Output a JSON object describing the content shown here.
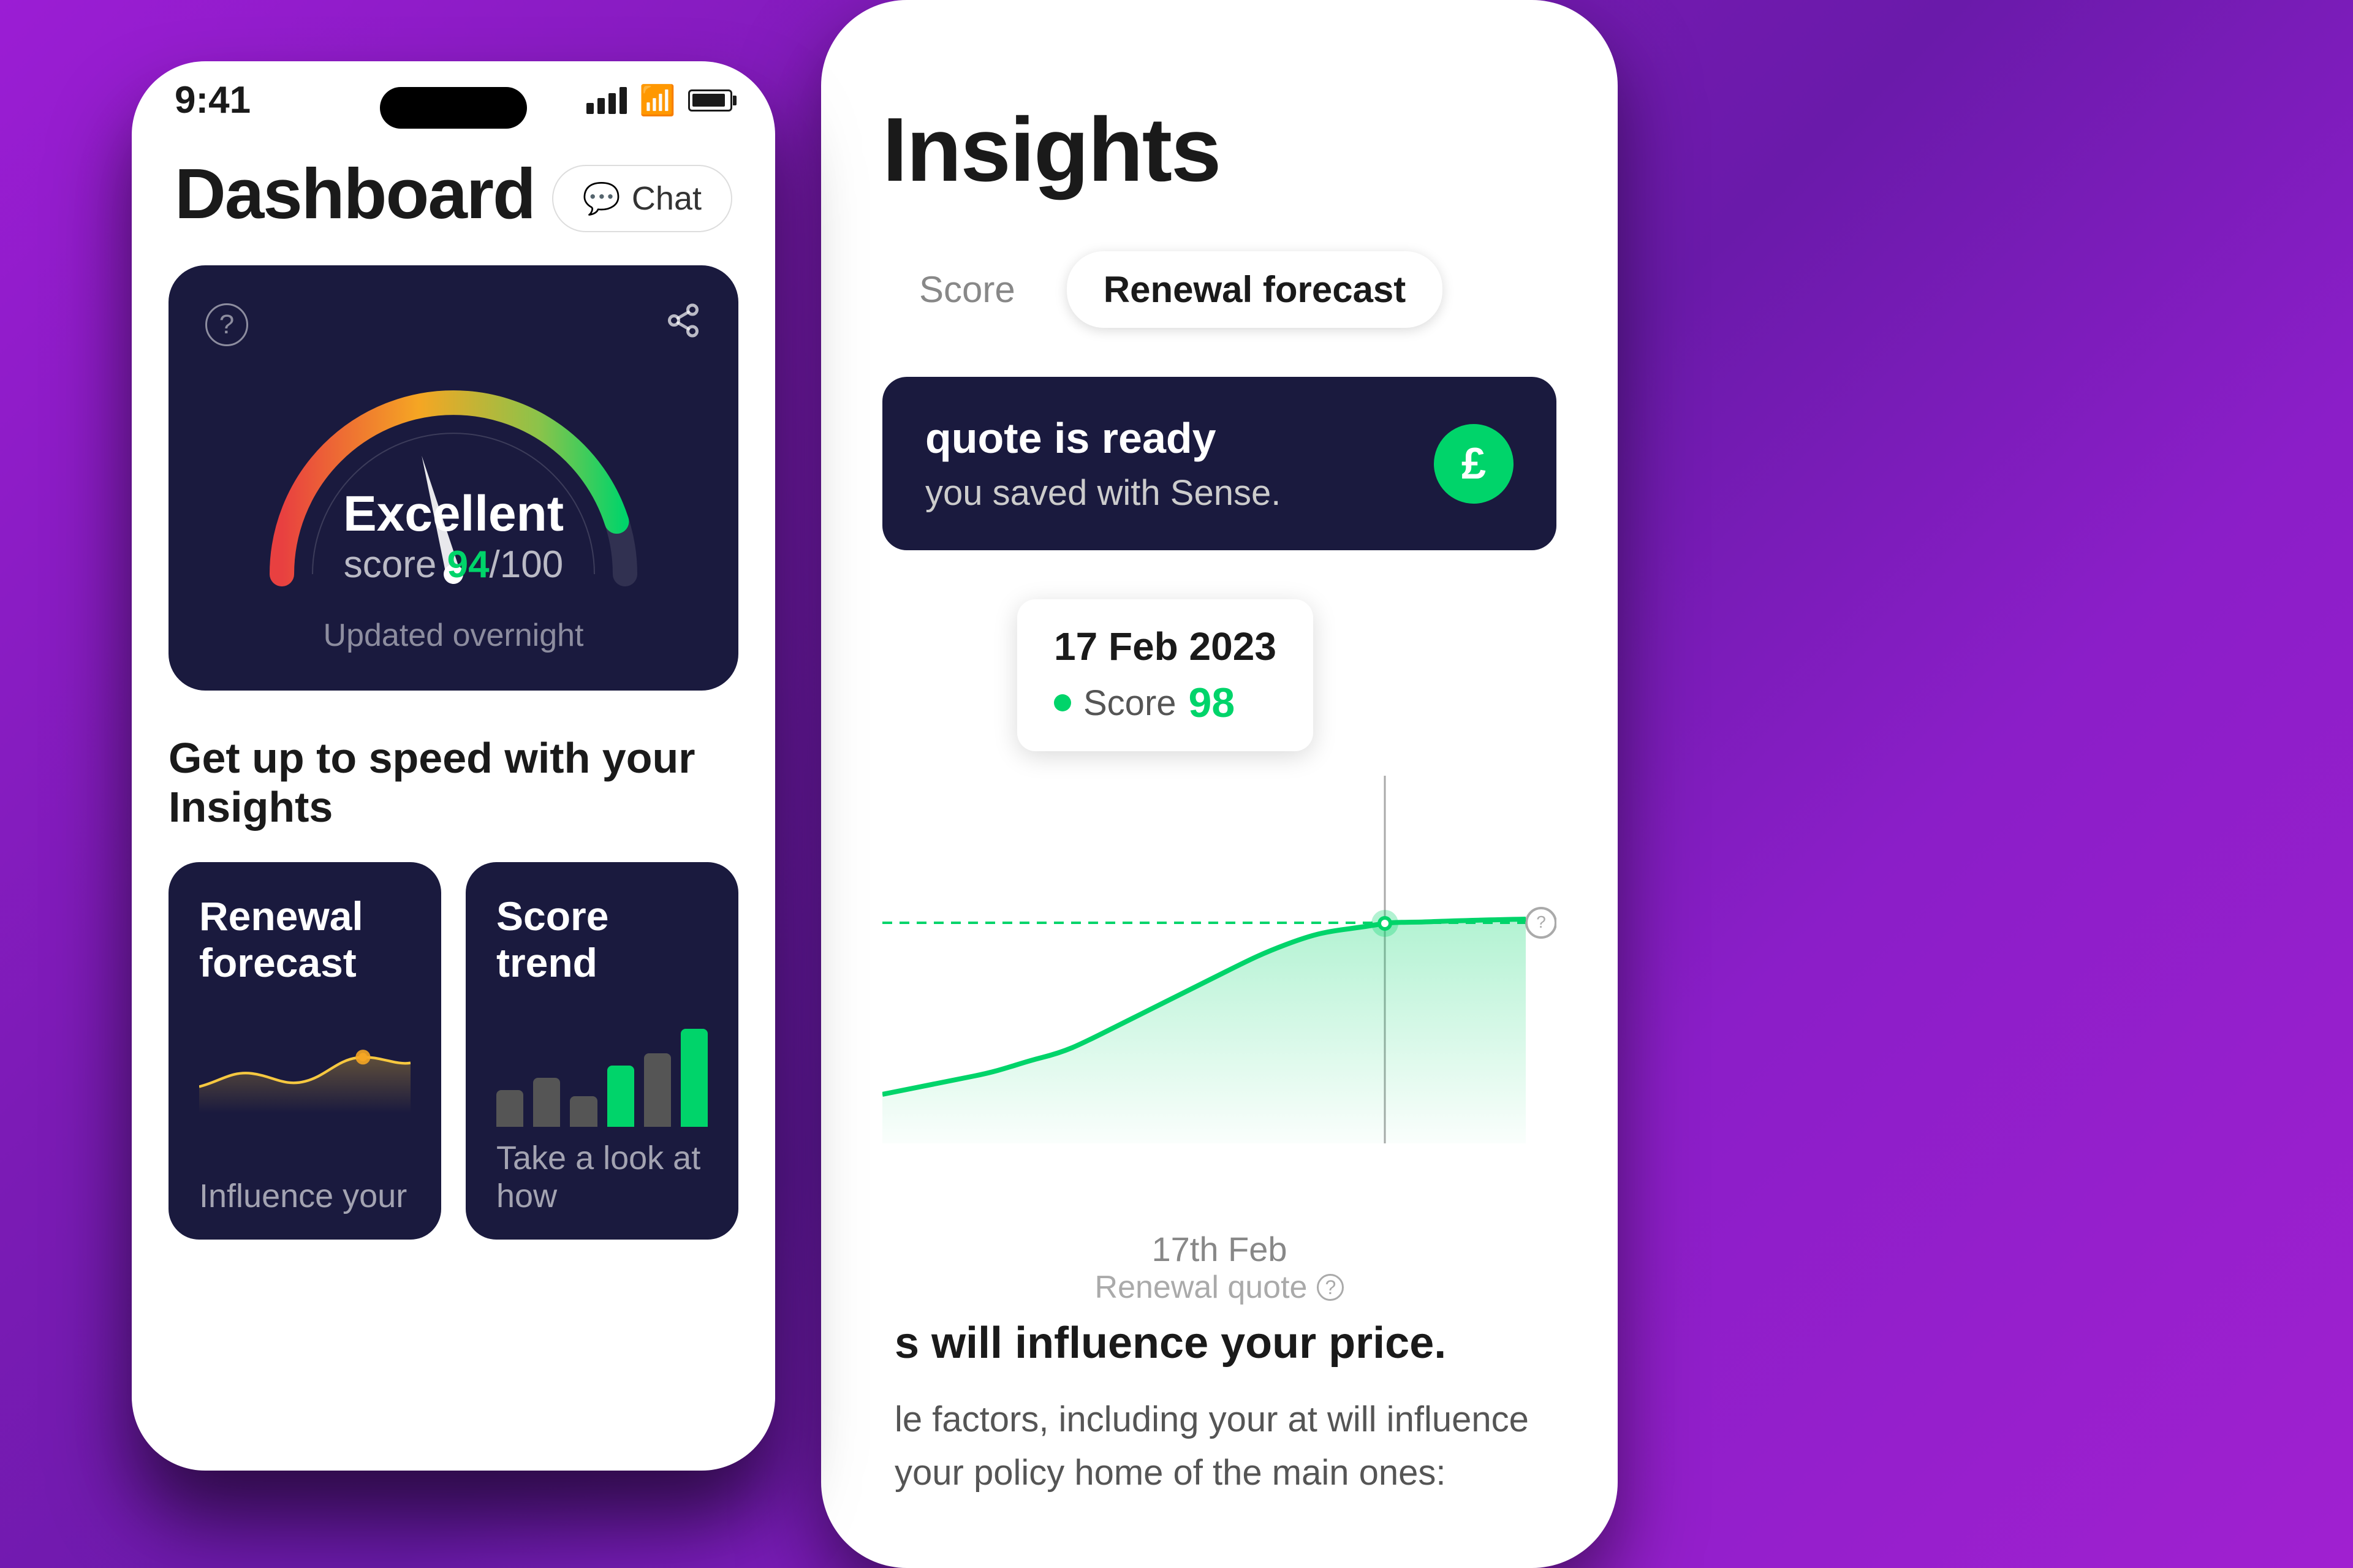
{
  "background": {
    "gradient_start": "#9b1dd4",
    "gradient_end": "#6a1aaa"
  },
  "back_phone": {
    "title": "Insights",
    "tabs": [
      {
        "label": "Score",
        "active": false
      },
      {
        "label": "Renewal forecast",
        "active": true
      }
    ],
    "banner": {
      "line1": "quote is ready",
      "line2": "you saved with Sense.",
      "badge": "£"
    },
    "tooltip": {
      "date": "17 Feb 2023",
      "score_label": "Score",
      "score_value": "98"
    },
    "chart_x_label": "17th Feb",
    "chart_x_sublabel": "Renewal quote",
    "influence": {
      "title": "s will influence your price.",
      "body": "le factors, including your\nat will influence your policy\nhome of the main ones:"
    }
  },
  "front_phone": {
    "status_bar": {
      "time": "9:41"
    },
    "header": {
      "title": "Dashboard",
      "chat_button": "Chat"
    },
    "score_card": {
      "rating": "Excellent",
      "score": "94",
      "score_max": "100",
      "updated": "Updated overnight"
    },
    "insights_section": {
      "heading": "Get up to speed with your Insights",
      "cards": [
        {
          "title": "Renewal forecast",
          "subtitle": "Influence your"
        },
        {
          "title": "Score trend",
          "subtitle": "Take a look at how"
        }
      ]
    }
  }
}
